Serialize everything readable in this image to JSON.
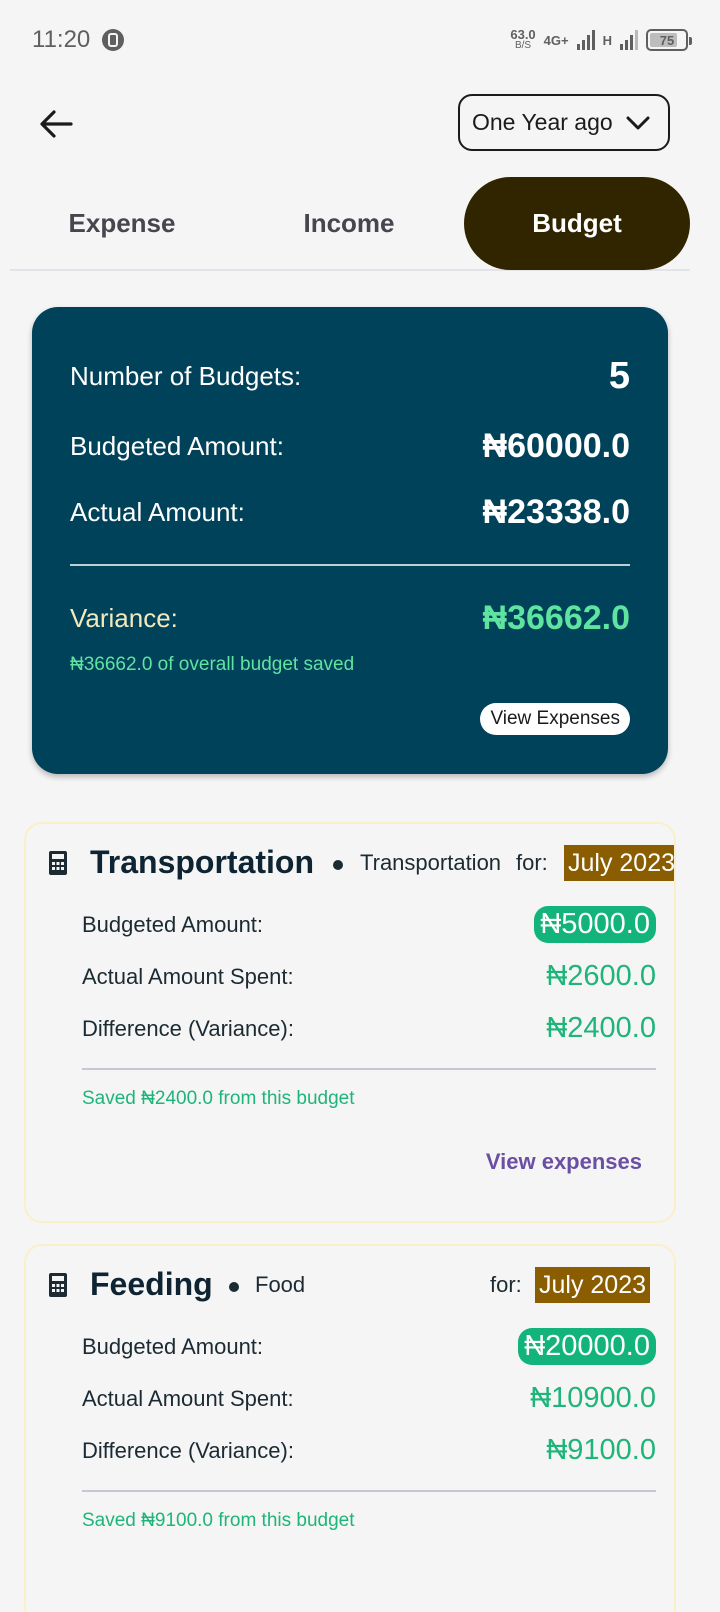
{
  "status_bar": {
    "time": "11:20",
    "net_speed_value": "63.0",
    "net_speed_unit": "B/S",
    "net_type_1": "4G+",
    "net_type_2": "H",
    "battery": "75"
  },
  "header": {
    "period": "One Year ago"
  },
  "tabs": [
    {
      "label": "Expense",
      "active": false
    },
    {
      "label": "Income",
      "active": false
    },
    {
      "label": "Budget",
      "active": true
    }
  ],
  "summary": {
    "count_label": "Number of Budgets:",
    "count_value": "5",
    "budgeted_label": "Budgeted Amount:",
    "budgeted_value": "₦60000.0",
    "actual_label": "Actual Amount:",
    "actual_value": "₦23338.0",
    "variance_label": "Variance:",
    "variance_value": "₦36662.0",
    "saved_note": "₦36662.0 of overall budget saved",
    "button_label": "View Expenses"
  },
  "budgets": [
    {
      "title": "Transportation",
      "category": "Transportation",
      "for_label": "for:",
      "date": "July 2023",
      "budgeted_label": "Budgeted Amount:",
      "budgeted_value": "₦5000.0",
      "actual_label": "Actual Amount Spent:",
      "actual_value": "₦2600.0",
      "difference_label": "Difference (Variance):",
      "difference_value": "₦2400.0",
      "saved_text": "Saved ₦2400.0 from this budget",
      "link_label": "View expenses"
    },
    {
      "title": "Feeding",
      "category": "Food",
      "for_label": "for:",
      "date": "July 2023",
      "budgeted_label": "Budgeted Amount:",
      "budgeted_value": "₦20000.0",
      "actual_label": "Actual Amount Spent:",
      "actual_value": "₦10900.0",
      "difference_label": "Difference (Variance):",
      "difference_value": "₦9100.0",
      "saved_text": "Saved ₦9100.0 from this budget"
    }
  ],
  "colors": {
    "summary_bg": "#00425a",
    "active_tab_bg": "#312500",
    "positive": "#1fb57a",
    "date_badge": "#8a5d00",
    "link": "#6a4fa3"
  }
}
